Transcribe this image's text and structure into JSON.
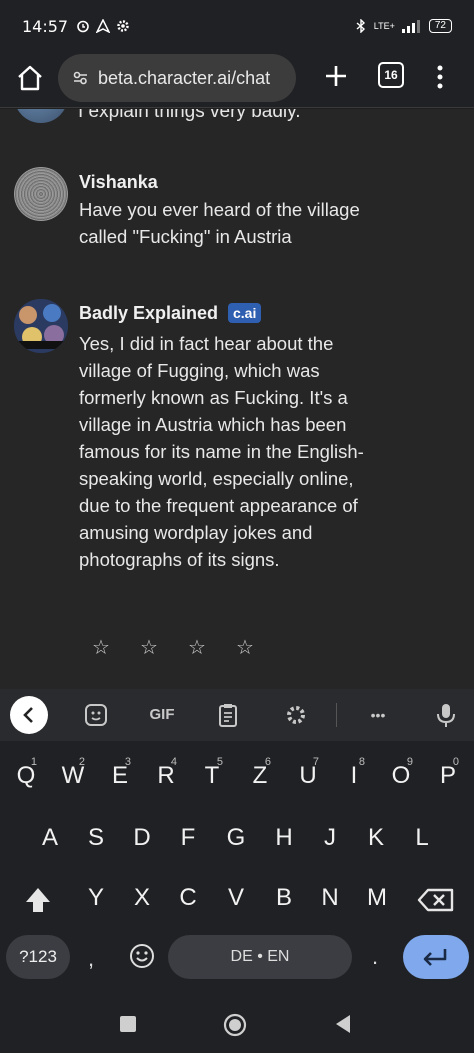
{
  "status_bar": {
    "time": "14:57",
    "network": "LTE+",
    "battery": "72"
  },
  "browser": {
    "url": "beta.character.ai/chat",
    "tab_count": "16"
  },
  "chat": {
    "partial_message": "I explain things very badly.",
    "messages": [
      {
        "name": "Vishanka",
        "text": "Have you ever heard of the village called \"Fucking\" in Austria"
      },
      {
        "name": "Badly Explained",
        "badge": "c.ai",
        "text": "Yes, I did in fact hear about the village of Fugging, which was formerly known as Fucking. It's a village in Austria which has been famous for its name in the English-speaking world, especially online, due to the frequent appearance of amusing wordplay jokes and photographs of its signs."
      }
    ],
    "rating_stars": [
      "☆",
      "☆",
      "☆",
      "☆"
    ]
  },
  "keyboard": {
    "toolbar_gif": "GIF",
    "toolbar_more": "•••",
    "row1": [
      {
        "k": "Q",
        "n": "1"
      },
      {
        "k": "W",
        "n": "2"
      },
      {
        "k": "E",
        "n": "3"
      },
      {
        "k": "R",
        "n": "4"
      },
      {
        "k": "T",
        "n": "5"
      },
      {
        "k": "Z",
        "n": "6"
      },
      {
        "k": "U",
        "n": "7"
      },
      {
        "k": "I",
        "n": "8"
      },
      {
        "k": "O",
        "n": "9"
      },
      {
        "k": "P",
        "n": "0"
      }
    ],
    "row2": [
      "A",
      "S",
      "D",
      "F",
      "G",
      "H",
      "J",
      "K",
      "L"
    ],
    "row3": [
      "Y",
      "X",
      "C",
      "V",
      "B",
      "N",
      "M"
    ],
    "symbols_label": "?123",
    "comma": ",",
    "space_label": "DE • EN",
    "period": "."
  }
}
